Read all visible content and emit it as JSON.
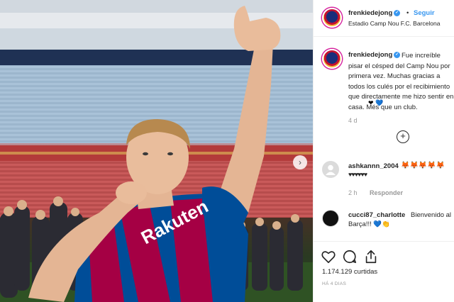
{
  "post": {
    "username": "frenkiedejong",
    "follow_label": "Seguir",
    "separator": "•",
    "location": "Estadio Camp Nou F.C. Barcelona",
    "caption_text": "Fue increíble pisar el césped del Camp Nou por primera vez. Muchas gracias a todos los culés por el recibimiento que directamente me hizo sentir en casa. Més que un club.",
    "caption_hearts": "❤ 💙",
    "caption_time": "4 d",
    "more_label": "+",
    "photo_jersey_text": "Rakuten"
  },
  "comments": [
    {
      "username": "ashkannn_2004",
      "text_emoji": "🦊🦊🦊🦊🦊",
      "text_line2": "♥♥♥♥♥♥",
      "time": "2 h",
      "reply_label": "Responder"
    },
    {
      "username": "cucci87_charlotte",
      "text": "Bienvenido al",
      "text_line2": "Barça!!! 💙👏"
    }
  ],
  "actions": {
    "likes_count": "1.174.129",
    "likes_label": "curtidas",
    "posted_ago": "HÁ 4 DIAS"
  },
  "colors": {
    "accent": "#3897f0",
    "verified": "#3897f0",
    "jersey_red": "#a50044",
    "jersey_blue": "#004d98"
  },
  "icons": [
    "verified-icon",
    "heart-icon",
    "comment-icon",
    "share-icon",
    "chevron-right-icon",
    "plus-circle-icon",
    "default-avatar-icon"
  ]
}
